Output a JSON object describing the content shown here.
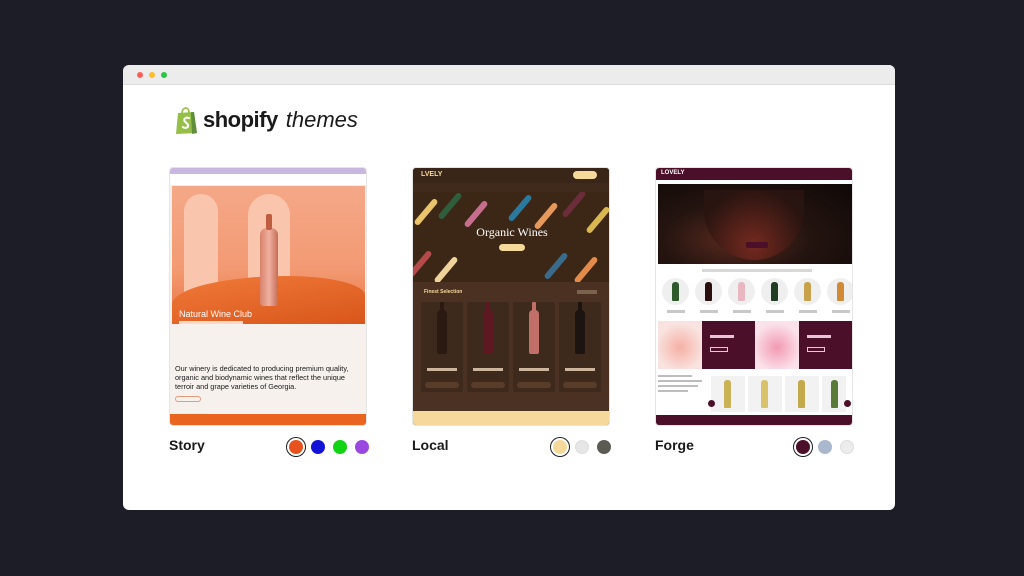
{
  "brand": {
    "name": "shopify",
    "sub": "themes"
  },
  "themes": [
    {
      "name": "Story",
      "preview": {
        "hero_title": "Natural Wine Club",
        "description": "Our winery is dedicated to producing premium quality, organic and biodynamic wines that reflect the unique terroir and grape varieties of Georgia."
      },
      "swatches": [
        {
          "color": "#e8521f",
          "selected": true
        },
        {
          "color": "#1313d8",
          "selected": false
        },
        {
          "color": "#10d414",
          "selected": false
        },
        {
          "color": "#9a49e0",
          "selected": false
        }
      ]
    },
    {
      "name": "Local",
      "preview": {
        "brand": "LVELY",
        "hero_title": "Organic Wines",
        "section_title": "Finest Selection"
      },
      "swatches": [
        {
          "color": "#f4d99a",
          "selected": true
        },
        {
          "color": "#e6e6e6",
          "selected": false
        },
        {
          "color": "#5b5b52",
          "selected": false
        }
      ]
    },
    {
      "name": "Forge",
      "preview": {
        "brand": "LOVELY"
      },
      "swatches": [
        {
          "color": "#4b0f2a",
          "selected": true
        },
        {
          "color": "#a9b8cc",
          "selected": false
        },
        {
          "color": "#ececec",
          "selected": false
        }
      ]
    }
  ],
  "colors": {
    "background": "#1d1d27",
    "logo_green": "#95bf47"
  }
}
